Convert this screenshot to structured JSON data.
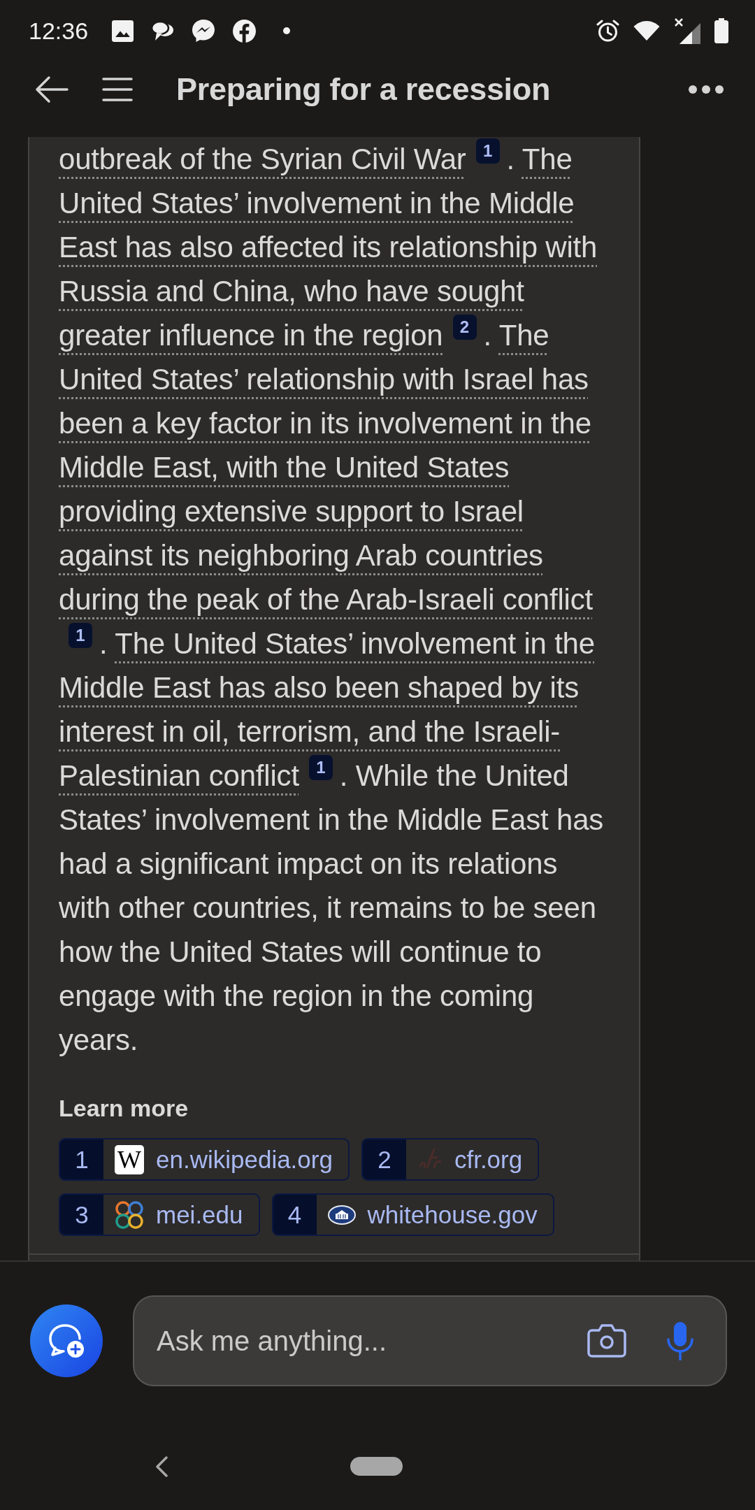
{
  "status_bar": {
    "time": "12:36"
  },
  "header": {
    "title": "Preparing for a recession"
  },
  "answer": {
    "segments": [
      {
        "kind": "cited",
        "text": "outbreak of the Syrian Civil War",
        "citation": "1"
      },
      {
        "kind": "plain",
        "text": ". "
      },
      {
        "kind": "cited",
        "text": "The United States’ involvement in the Middle East has also affected its relationship with Russia and China, who have sought greater influence in the region",
        "citation": "2"
      },
      {
        "kind": "plain",
        "text": ". "
      },
      {
        "kind": "cited",
        "text": "The United States’ relationship with Israel has been a key factor in its involvement in the Middle East, with the United States providing extensive support to Israel against its neighboring Arab countries during the peak of the Arab-Israeli conflict",
        "citation": "1"
      },
      {
        "kind": "plain",
        "text": ". "
      },
      {
        "kind": "cited",
        "text": "The United States’ involvement in the Middle East has also been shaped by its interest in oil, terrorism, and the Israeli-Palestinian conflict",
        "citation": "1"
      },
      {
        "kind": "plain",
        "text": ". While the United States’ involvement in the Middle East has had a significant impact on its relations with other countries, it remains to be seen how the United States will continue to engage with the region in the coming years."
      }
    ]
  },
  "learn_more": {
    "title": "Learn more",
    "sources": [
      {
        "number": "1",
        "kind": "letter",
        "letter": "W",
        "domain": "en.wikipedia.org"
      },
      {
        "number": "2",
        "kind": "faded",
        "domain": "cfr.org"
      },
      {
        "number": "3",
        "kind": "knot",
        "domain": "mei.edu"
      },
      {
        "number": "4",
        "kind": "emblem",
        "domain": "whitehouse.gov"
      }
    ]
  },
  "composer": {
    "placeholder": "Ask me anything..."
  }
}
